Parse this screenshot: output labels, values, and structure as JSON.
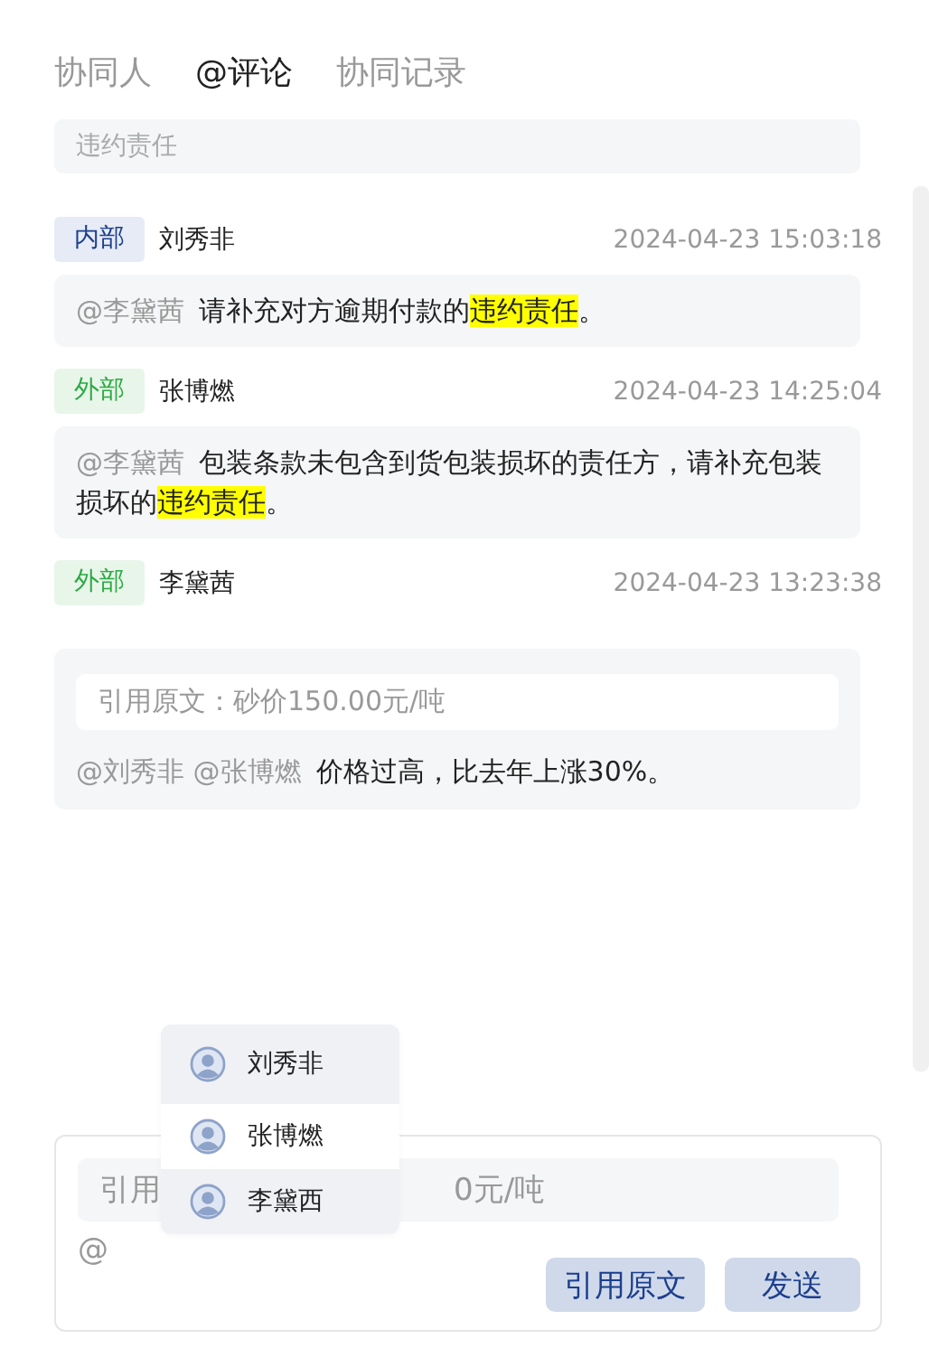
{
  "tabs": [
    {
      "label": "协同人",
      "selected": false
    },
    {
      "label": "@评论",
      "selected": true
    },
    {
      "label": "协同记录",
      "selected": false
    }
  ],
  "search": {
    "placeholder": "违约责任"
  },
  "comments": [
    {
      "tag": {
        "label": "内部",
        "kind": "internal"
      },
      "author": "刘秀非",
      "time": "2024-04-23 15:03:18",
      "parts": [
        {
          "kind": "mention",
          "text": "@李黛茜"
        },
        {
          "kind": "text",
          "text": "请补充对方逾期付款的"
        },
        {
          "kind": "highlight",
          "text": "违约责任"
        },
        {
          "kind": "text",
          "text": "。"
        }
      ]
    },
    {
      "tag": {
        "label": "外部",
        "kind": "external"
      },
      "author": "张博燃",
      "time": "2024-04-23 14:25:04",
      "parts": [
        {
          "kind": "mention",
          "text": "@李黛茜"
        },
        {
          "kind": "text",
          "text": "包装条款未包含到货包装损坏的责任方，请补充包装损坏的"
        },
        {
          "kind": "highlight",
          "text": "违约责任"
        },
        {
          "kind": "text",
          "text": "。"
        }
      ]
    },
    {
      "tag": {
        "label": "外部",
        "kind": "external"
      },
      "author": "李黛茜",
      "time": "2024-04-23 13:23:38",
      "quote": "引用原文：砂价150.00元/吨",
      "parts": [
        {
          "kind": "mention",
          "text": "@刘秀非 @张博燃"
        },
        {
          "kind": "text",
          "text": "价格过高，比去年上涨30%。"
        }
      ]
    }
  ],
  "mention_menu": [
    {
      "name": "刘秀非",
      "selected": false
    },
    {
      "name": "张博燃",
      "selected": true
    },
    {
      "name": "李黛西",
      "selected": false
    }
  ],
  "composer": {
    "quote_start": "引用",
    "quote_end": "0元/吨",
    "value": "@",
    "buttons": [
      "引用原文",
      "发送"
    ]
  }
}
